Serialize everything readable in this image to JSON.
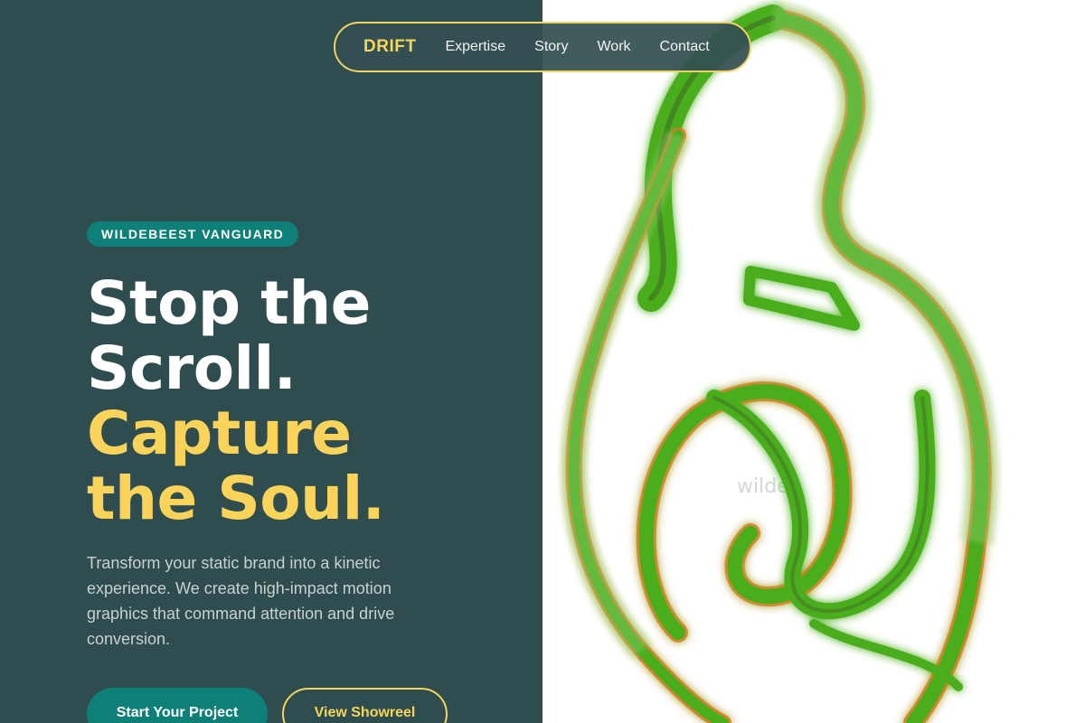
{
  "nav": {
    "brand": "DRIFT",
    "links": [
      "Expertise",
      "Story",
      "Work",
      "Contact"
    ]
  },
  "hero": {
    "tag": "WILDEBEEST VANGUARD",
    "headline_white": [
      "Stop the",
      "Scroll."
    ],
    "headline_gold": [
      "Capture",
      "the Soul."
    ],
    "description": "Transform your static brand into a kinetic experience. We create high-impact motion graphics that command attention and drive conversion.",
    "primary_cta": "Start Your Project",
    "secondary_cta": "View Showreel"
  },
  "art": {
    "ghost_text": "wildeb"
  },
  "colors": {
    "panel_bg": "#2f4c4f",
    "accent_teal": "#0f8078",
    "accent_gold": "#f5d55c",
    "art_green": "#4aad1c",
    "art_orange": "#d27a1e"
  }
}
